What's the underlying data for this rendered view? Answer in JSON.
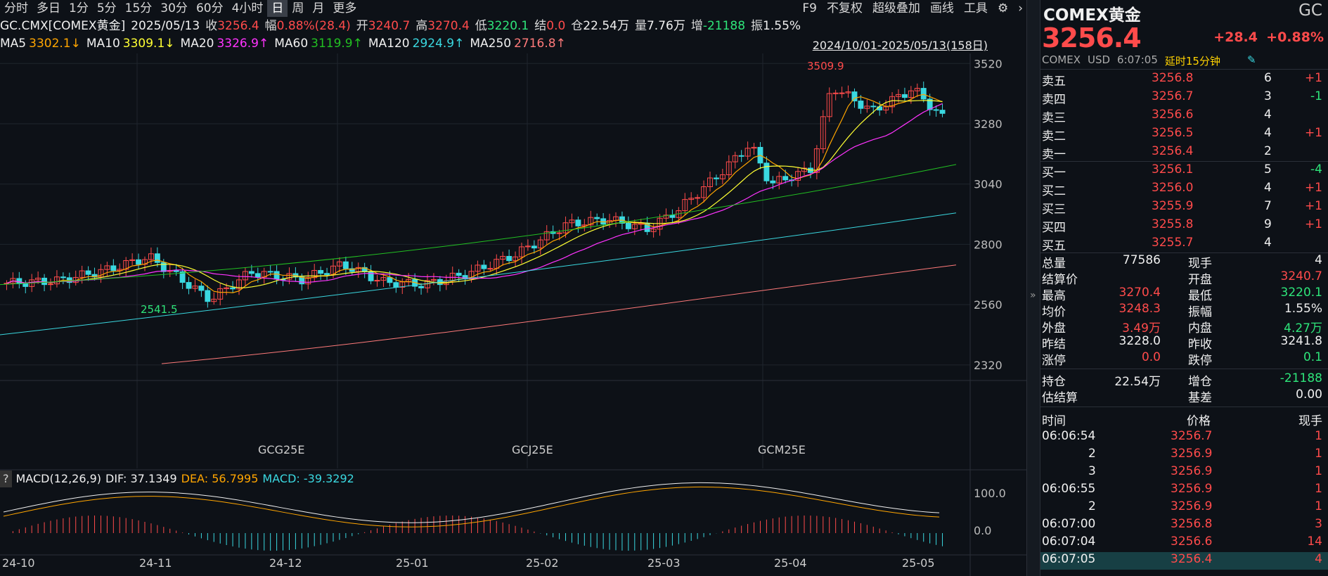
{
  "toolbar": {
    "periods": [
      "分时",
      "多日",
      "1分",
      "5分",
      "15分",
      "30分",
      "60分",
      "4小时",
      "日",
      "周",
      "月",
      "更多"
    ],
    "active_period": "日",
    "right_items": [
      "F9",
      "不复权",
      "超级叠加",
      "画线",
      "工具"
    ]
  },
  "info": {
    "symbol": "GC.CMX[COMEX黄金]",
    "date": "2025/05/13",
    "close_label": "收",
    "close": "3256.4",
    "amp_label": "幅",
    "amp": "0.88%(28.4)",
    "open_label": "开",
    "open": "3240.7",
    "high_label": "高",
    "high": "3270.4",
    "low_label": "低",
    "low": "3220.1",
    "settle_label": "结",
    "settle": "0.0",
    "oi_label": "仓",
    "oi": "22.54万",
    "vol_label": "量",
    "vol": "7.76万",
    "inc_label": "增",
    "inc": "-21188",
    "swing_label": "振",
    "swing": "1.55%"
  },
  "ma": [
    {
      "label": "MA5",
      "value": "3302.1↓",
      "color": "#ffa500"
    },
    {
      "label": "MA10",
      "value": "3309.1↓",
      "color": "#ffff33"
    },
    {
      "label": "MA20",
      "value": "3326.9↑",
      "color": "#ff33ff"
    },
    {
      "label": "MA60",
      "value": "3119.9↑",
      "color": "#22c022"
    },
    {
      "label": "MA120",
      "value": "2924.9↑",
      "color": "#3ad8e0"
    },
    {
      "label": "MA250",
      "value": "2716.8↑",
      "color": "#ff7a7a"
    }
  ],
  "range_label": "2024/10/01-2025/05/13(158日)",
  "chart_data": {
    "type": "candlestick",
    "y_ticks": [
      "3520",
      "3280",
      "3040",
      "2800",
      "2560",
      "2320"
    ],
    "ylim": [
      2300,
      3560
    ],
    "x_ticks": [
      "24-10",
      "24-11",
      "24-12",
      "25-01",
      "25-02",
      "25-03",
      "25-04",
      "25-05"
    ],
    "contract_labels": [
      "GCG25E",
      "GCJ25E",
      "GCM25E"
    ],
    "high_annotation": "3509.9",
    "low_annotation": "2541.5",
    "macd": {
      "label": "MACD(12,26,9)",
      "dif_label": "DIF:",
      "dif": "37.1349",
      "dea_label": "DEA:",
      "dea": "56.7995",
      "macd_label": "MACD:",
      "macd": "-39.3292",
      "y_ticks": [
        "100.0",
        "0.0"
      ]
    }
  },
  "quote": {
    "name": "COMEX黄金",
    "code": "GC",
    "price": "3256.4",
    "change": "+28.4",
    "change_pct": "+0.88%",
    "exchange": "COMEX",
    "currency": "USD",
    "time": "6:07:05",
    "delay": "延时15分钟"
  },
  "asks": [
    {
      "label": "卖五",
      "price": "3256.8",
      "vol": "6",
      "chg": "+1"
    },
    {
      "label": "卖四",
      "price": "3256.7",
      "vol": "3",
      "chg": "-1"
    },
    {
      "label": "卖三",
      "price": "3256.6",
      "vol": "4",
      "chg": ""
    },
    {
      "label": "卖二",
      "price": "3256.5",
      "vol": "4",
      "chg": "+1"
    },
    {
      "label": "卖一",
      "price": "3256.4",
      "vol": "2",
      "chg": ""
    }
  ],
  "bids": [
    {
      "label": "买一",
      "price": "3256.1",
      "vol": "5",
      "chg": "-4"
    },
    {
      "label": "买二",
      "price": "3256.0",
      "vol": "4",
      "chg": "+1"
    },
    {
      "label": "买三",
      "price": "3255.9",
      "vol": "7",
      "chg": "+1"
    },
    {
      "label": "买四",
      "price": "3255.8",
      "vol": "9",
      "chg": "+1"
    },
    {
      "label": "买五",
      "price": "3255.7",
      "vol": "4",
      "chg": ""
    }
  ],
  "stats": [
    {
      "l1": "总量",
      "v1": "77586",
      "c1": "wh",
      "l2": "现手",
      "v2": "4",
      "c2": "wh"
    },
    {
      "l1": "结算价",
      "v1": "",
      "c1": "wh",
      "l2": "开盘",
      "v2": "3240.7",
      "c2": "up"
    },
    {
      "l1": "最高",
      "v1": "3270.4",
      "c1": "up",
      "l2": "最低",
      "v2": "3220.1",
      "c2": "dn"
    },
    {
      "l1": "均价",
      "v1": "3248.3",
      "c1": "up",
      "l2": "振幅",
      "v2": "1.55%",
      "c2": "wh"
    },
    {
      "l1": "外盘",
      "v1": "3.49万",
      "c1": "up",
      "l2": "内盘",
      "v2": "4.27万",
      "c2": "dn"
    },
    {
      "l1": "昨结",
      "v1": "3228.0",
      "c1": "wh",
      "l2": "昨收",
      "v2": "3241.8",
      "c2": "wh"
    },
    {
      "l1": "涨停",
      "v1": "0.0",
      "c1": "up",
      "l2": "跌停",
      "v2": "0.1",
      "c2": "dn"
    }
  ],
  "stats2": [
    {
      "l1": "持仓",
      "v1": "22.54万",
      "c1": "wh",
      "l2": "增仓",
      "v2": "-21188",
      "c2": "dn"
    },
    {
      "l1": "估结算",
      "v1": "",
      "c1": "wh",
      "l2": "基差",
      "v2": "0.00",
      "c2": "wh"
    }
  ],
  "ticks_header": {
    "time": "时间",
    "price": "价格",
    "vol": "现手"
  },
  "ticks": [
    {
      "time": "06:06:54",
      "price": "3256.7",
      "vol": "1"
    },
    {
      "time": "2",
      "price": "3256.9",
      "vol": "1"
    },
    {
      "time": "3",
      "price": "3256.9",
      "vol": "1"
    },
    {
      "time": "06:06:55",
      "price": "3256.9",
      "vol": "1"
    },
    {
      "time": "2",
      "price": "3256.9",
      "vol": "1"
    },
    {
      "time": "06:07:00",
      "price": "3256.8",
      "vol": "3"
    },
    {
      "time": "06:07:04",
      "price": "3256.6",
      "vol": "14"
    },
    {
      "time": "06:07:05",
      "price": "3256.4",
      "vol": "4"
    }
  ]
}
